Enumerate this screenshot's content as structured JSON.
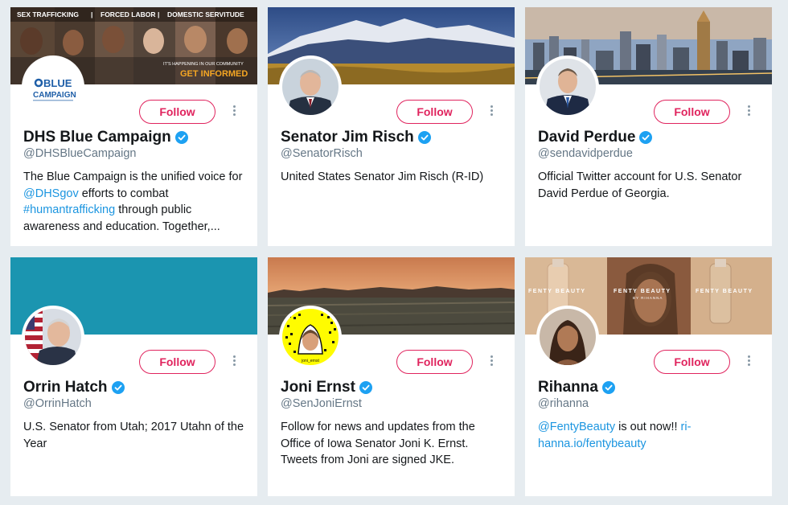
{
  "follow_label": "Follow",
  "colors": {
    "accent": "#e0245e",
    "link": "#1b95e0",
    "verified": "#1da1f2",
    "background": "#e6ecf0"
  },
  "cards": [
    {
      "name": "DHS Blue Campaign",
      "handle": "@DHSBlueCampaign",
      "banner_text": [
        "SEX TRAFFICKING",
        "|",
        "FORCED LABOR",
        "|",
        "DOMESTIC SERVITUDE"
      ],
      "banner_subtext": "IT'S HAPPENING IN OUR COMMUNITY",
      "banner_cta": "GET INFORMED",
      "avatar_logo_top": "BLUE",
      "avatar_logo_bottom": "CAMPAIGN",
      "bio": [
        "The Blue Campaign is the unified voice for ",
        "@DHSgov",
        " efforts to combat ",
        "#humantrafficking",
        " through public awareness and education. Together,..."
      ]
    },
    {
      "name": "Senator Jim Risch",
      "handle": "@SenatorRisch",
      "bio": [
        "United States Senator Jim Risch (R-ID)"
      ]
    },
    {
      "name": "David Perdue",
      "handle": "@sendavidperdue",
      "bio": [
        "Official Twitter account for U.S. Senator David Perdue of Georgia."
      ]
    },
    {
      "name": "Orrin Hatch",
      "handle": "@OrrinHatch",
      "bio": [
        "U.S. Senator from Utah; 2017 Utahn of the Year"
      ]
    },
    {
      "name": "Joni Ernst",
      "handle": "@SenJoniErnst",
      "avatar_caption": "joni_ernst",
      "bio": [
        "Follow for news and updates from the Office of Iowa Senator Joni K. Ernst. Tweets from Joni are signed JKE."
      ]
    },
    {
      "name": "Rihanna",
      "handle": "@rihanna",
      "banner_text": [
        "FENTY BEAUTY",
        "FENTY BEAUTY",
        "FENTY BEAUTY"
      ],
      "banner_subtext": "BY RIHANNA",
      "bio": [
        "@FentyBeauty",
        " is out now!! ",
        "ri-hanna.io/fentybeauty"
      ]
    }
  ]
}
